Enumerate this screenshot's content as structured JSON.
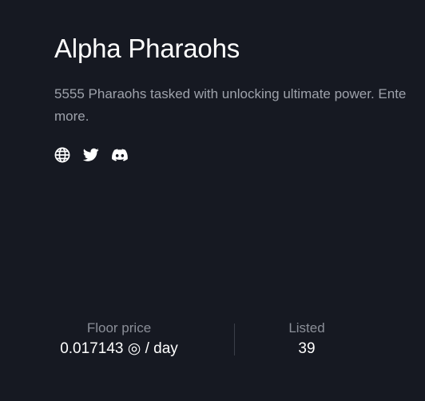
{
  "collection": {
    "title": "Alpha Pharaohs",
    "description": "5555 Pharaohs tasked with unlocking ultimate power. Ente",
    "description_more": "more."
  },
  "social": [
    {
      "name": "website",
      "icon": "globe-icon"
    },
    {
      "name": "twitter",
      "icon": "twitter-icon"
    },
    {
      "name": "discord",
      "icon": "discord-icon"
    }
  ],
  "stats": {
    "floor_label": "Floor price",
    "floor_value": "0.017143 ◎ / day",
    "listed_label": "Listed",
    "listed_value": "39"
  },
  "colors": {
    "background": "#161922",
    "text": "#ffffff",
    "muted": "#9ea2ab"
  }
}
